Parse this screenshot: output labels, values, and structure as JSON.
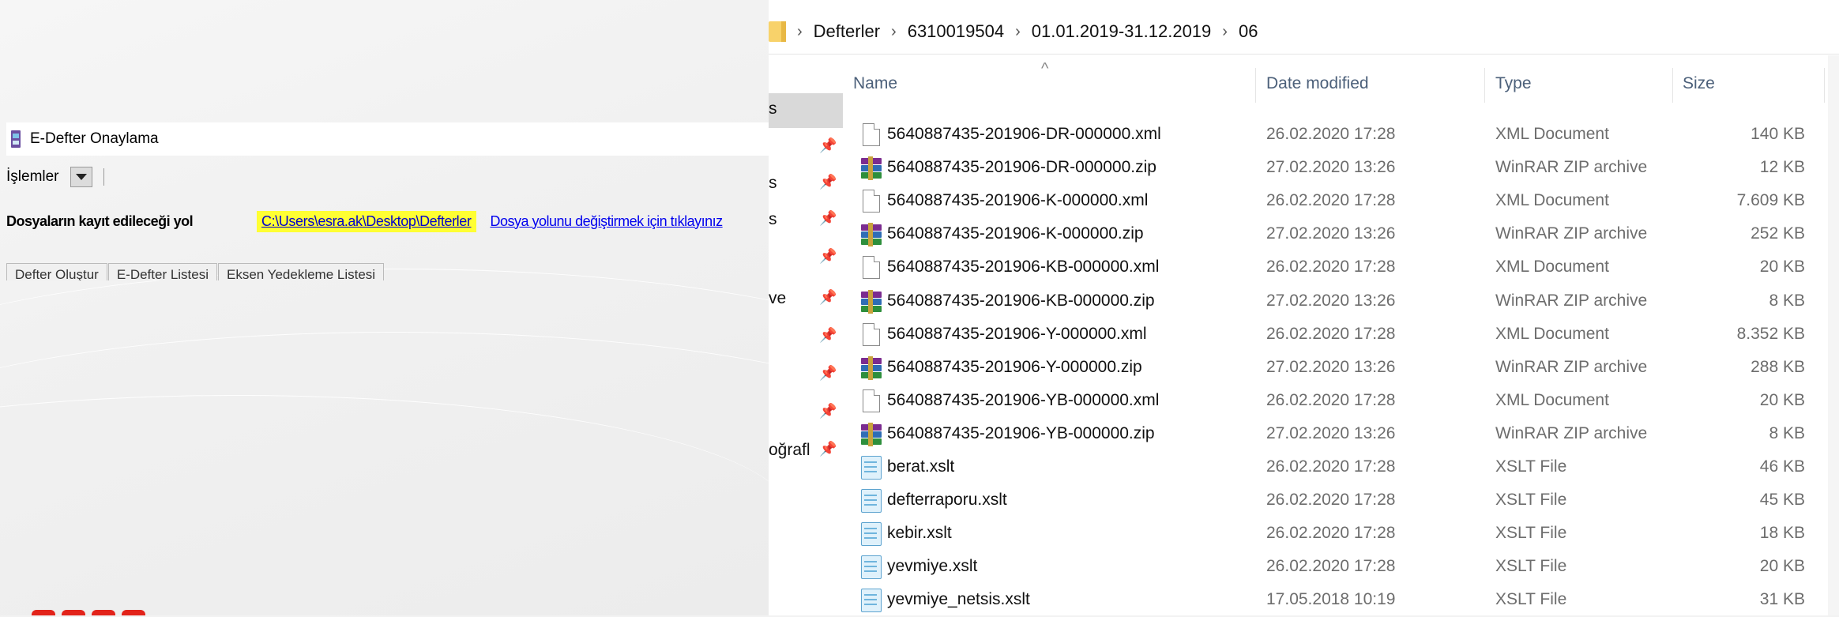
{
  "edefter": {
    "title": "E-Defter Onaylama",
    "menu": {
      "islemler": "İşlemler"
    },
    "path_label": "Dosyaların kayıt edileceği yol",
    "path_value": "C:\\Users\\esra.ak\\Desktop\\Defterler",
    "path_change": "Dosya yolunu değiştirmek için tıklayınız",
    "tabs": [
      "Defter Oluştur",
      "E-Defter Listesi",
      "Eksen Yedekleme Listesi"
    ]
  },
  "explorer": {
    "breadcrumb": [
      "Defterler",
      "6310019504",
      "01.01.2019-31.12.2019",
      "06"
    ],
    "nav_items": [
      {
        "label": "s",
        "pinned": false
      },
      {
        "label": "",
        "pinned": true
      },
      {
        "label": "s",
        "pinned": true
      },
      {
        "label": "s",
        "pinned": true
      },
      {
        "label": "ve",
        "pinned": true
      },
      {
        "label": "",
        "pinned": true
      },
      {
        "label": "",
        "pinned": true
      },
      {
        "label": "",
        "pinned": true
      },
      {
        "label": "oğrafl",
        "pinned": true
      }
    ],
    "columns": {
      "name": "Name",
      "date": "Date modified",
      "type": "Type",
      "size": "Size"
    },
    "files": [
      {
        "name": "5640887435-201906-DR-000000.xml",
        "date": "26.02.2020 17:28",
        "type": "XML Document",
        "size": "140 KB",
        "icon": "xml-document-icon"
      },
      {
        "name": "5640887435-201906-DR-000000.zip",
        "date": "27.02.2020 13:26",
        "type": "WinRAR ZIP archive",
        "size": "12 KB",
        "icon": "winrar-archive-icon"
      },
      {
        "name": "5640887435-201906-K-000000.xml",
        "date": "26.02.2020 17:28",
        "type": "XML Document",
        "size": "7.609 KB",
        "icon": "xml-document-icon"
      },
      {
        "name": "5640887435-201906-K-000000.zip",
        "date": "27.02.2020 13:26",
        "type": "WinRAR ZIP archive",
        "size": "252 KB",
        "icon": "winrar-archive-icon"
      },
      {
        "name": "5640887435-201906-KB-000000.xml",
        "date": "26.02.2020 17:28",
        "type": "XML Document",
        "size": "20 KB",
        "icon": "xml-document-icon"
      },
      {
        "name": "5640887435-201906-KB-000000.zip",
        "date": "27.02.2020 13:26",
        "type": "WinRAR ZIP archive",
        "size": "8 KB",
        "icon": "winrar-archive-icon"
      },
      {
        "name": "5640887435-201906-Y-000000.xml",
        "date": "26.02.2020 17:28",
        "type": "XML Document",
        "size": "8.352 KB",
        "icon": "xml-document-icon"
      },
      {
        "name": "5640887435-201906-Y-000000.zip",
        "date": "27.02.2020 13:26",
        "type": "WinRAR ZIP archive",
        "size": "288 KB",
        "icon": "winrar-archive-icon"
      },
      {
        "name": "5640887435-201906-YB-000000.xml",
        "date": "26.02.2020 17:28",
        "type": "XML Document",
        "size": "20 KB",
        "icon": "xml-document-icon"
      },
      {
        "name": "5640887435-201906-YB-000000.zip",
        "date": "27.02.2020 13:26",
        "type": "WinRAR ZIP archive",
        "size": "8 KB",
        "icon": "winrar-archive-icon"
      },
      {
        "name": "berat.xslt",
        "date": "26.02.2020 17:28",
        "type": "XSLT File",
        "size": "46 KB",
        "icon": "xslt-file-icon"
      },
      {
        "name": "defterraporu.xslt",
        "date": "26.02.2020 17:28",
        "type": "XSLT File",
        "size": "45 KB",
        "icon": "xslt-file-icon"
      },
      {
        "name": "kebir.xslt",
        "date": "26.02.2020 17:28",
        "type": "XSLT File",
        "size": "18 KB",
        "icon": "xslt-file-icon"
      },
      {
        "name": "yevmiye.xslt",
        "date": "26.02.2020 17:28",
        "type": "XSLT File",
        "size": "20 KB",
        "icon": "xslt-file-icon"
      },
      {
        "name": "yevmiye_netsis.xslt",
        "date": "17.05.2018 10:19",
        "type": "XSLT File",
        "size": "31 KB",
        "icon": "xslt-file-icon"
      }
    ]
  }
}
